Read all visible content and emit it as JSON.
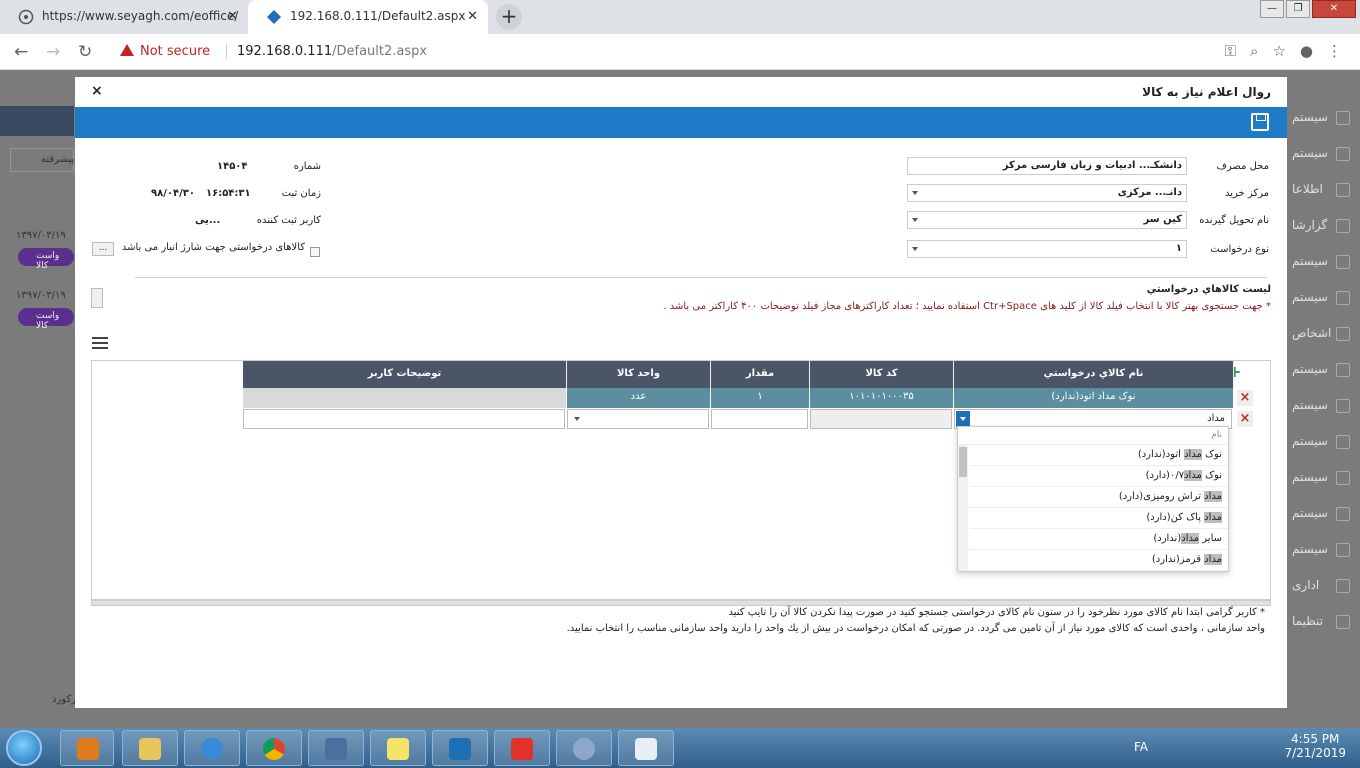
{
  "browser": {
    "tab1_title": "https://www.seyagh.com/eoffice/",
    "tab2_title": "192.168.0.111/Default2.aspx",
    "not_secure": "Not secure",
    "url_host": "192.168.0.111",
    "url_path": "/Default2.aspx"
  },
  "background": {
    "left_dates": [
      "۱۳۹۷/۰۳/۱۹",
      "۱۳۹۷/۰۳/۱۹"
    ],
    "left_pills": [
      "واست کالا",
      "واست کالا"
    ],
    "advanced": "پیشرفته",
    "right_items": [
      "سیستم",
      "سیستم",
      "اطلاعا",
      "گزارشا",
      "سیستم",
      "سیستم",
      "اشخاص",
      "سیستم",
      "سیستم",
      "سیستم",
      "سیستم",
      "سیستم",
      "سیستم",
      "اداری",
      "تنظیما"
    ],
    "bottom_left": "رکورد"
  },
  "modal": {
    "title": "روال اعلام نیاز به کالا",
    "close": "×",
    "fields": {
      "number_label": "شماره",
      "number_value": "۱۴۵۰۴",
      "time_label": "زمان ثبت",
      "time_clock": "۱۶:۵۴:۳۱",
      "time_date": "۹۸/۰۴/۳۰",
      "user_label": "کاربر ثبت کننده",
      "user_value": "...یی",
      "charge_checkbox_label": "کالاهای درخواستی جهت شارژ انبار می باشد",
      "dots_button": "...",
      "usage_label": "محل مصرف",
      "usage_value": "دانشکـ... ادبیات و زبان فارسی مرکز",
      "center_label": "مرکز خرید",
      "center_value": "دانـ... مرکزی",
      "receiver_label": "نام تحویل گیرنده",
      "receiver_value": "کین سر",
      "type_label": "نوع درخواست",
      "type_value": "۱"
    },
    "list_title": "ليست كالاهاي درخواستي",
    "list_note": "* جهت جستجوی بهتر کالا با انتخاب فیلد کالا از کلید های Ctr+Space استفاده نمایید ؛ تعداد کاراکترهای مجاز فیلد توضیحات ۴۰۰ کاراکتر می باشد .",
    "grid": {
      "headers": [
        "نام كالاي درخواستي",
        "کد کالا",
        "مقدار",
        "واحد کالا",
        "توضیحات کاربر"
      ],
      "row1": [
        "نوک مداد اتود(ندارد)",
        "۱۰۱۰۱۰۱۰۰۰۳۵",
        "۱",
        "عدد",
        ""
      ],
      "row2_input": "مداد"
    },
    "dropdown": {
      "header": "نام",
      "items": [
        {
          "pre": "نوک ",
          "hl": "مداد",
          "post": " اتود(ندارد)"
        },
        {
          "pre": "نوک ",
          "hl": "مداد",
          "post": "۰/۷(دارد)"
        },
        {
          "pre": "",
          "hl": "مداد",
          "post": " تراش رومیزی(دارد)"
        },
        {
          "pre": "",
          "hl": "مداد",
          "post": " پاک کن(دارد)"
        },
        {
          "pre": "سایر ",
          "hl": "مداد",
          "post": "(ندارد)"
        },
        {
          "pre": "",
          "hl": "مداد",
          "post": " قرمز(ندارد)"
        }
      ]
    },
    "footer_note1": "* کاربر گرامی ابتدا نام کالای مورد نظرخود را در ستون نام کالای درخواستی جستجو کنید در صورت پیدا نکردن کالا آن را تایپ کنید",
    "footer_note2": "واحد سازمانی ، واحدی است که کالای مورد نیاز از آن تامین می گردد. در صورتی که امکان درخواست در بیش از یك واحد را دارید واحد سازمانی مناسب را انتخاب نمایید."
  },
  "taskbar": {
    "lang": "FA",
    "time": "4:55 PM",
    "date": "7/21/2019"
  },
  "colors": {
    "toolbar": "#1f7ac8",
    "grid_header": "#4a5568",
    "teal_row": "#5b8fa0"
  }
}
